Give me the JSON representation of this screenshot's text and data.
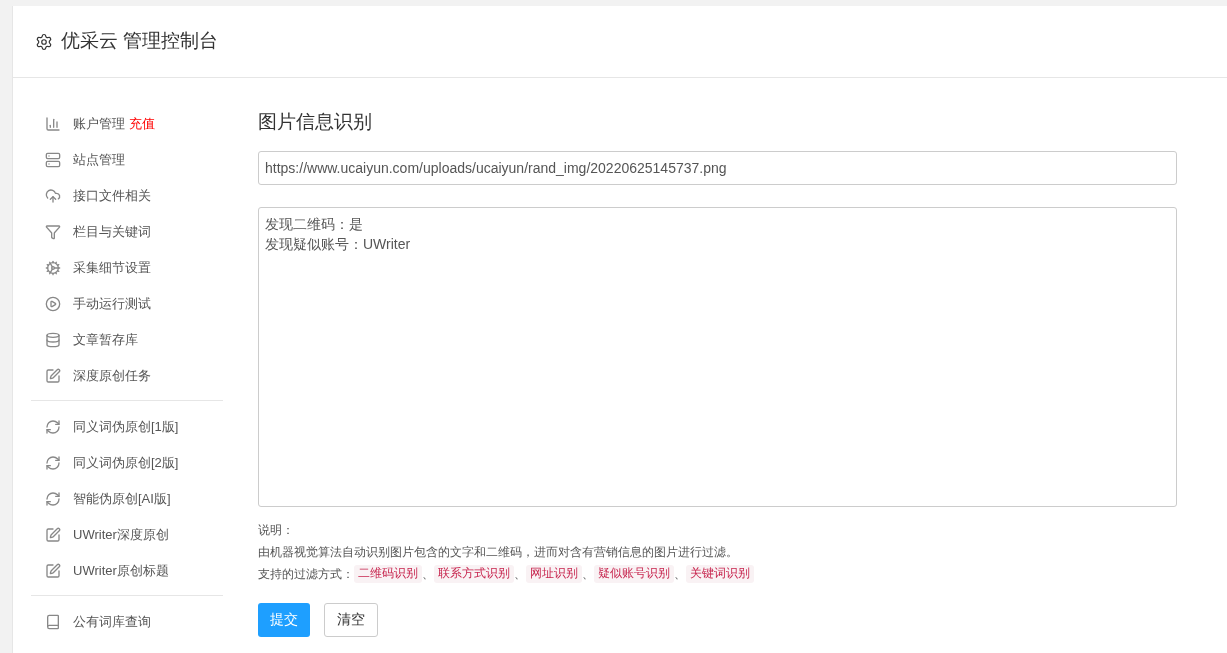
{
  "header": {
    "title": "优采云 管理控制台"
  },
  "sidebar": {
    "groups": [
      {
        "items": [
          {
            "label": "账户管理",
            "badge": "充值"
          },
          {
            "label": "站点管理"
          },
          {
            "label": "接口文件相关"
          },
          {
            "label": "栏目与关键词"
          },
          {
            "label": "采集细节设置"
          },
          {
            "label": "手动运行测试"
          },
          {
            "label": "文章暂存库"
          },
          {
            "label": "深度原创任务"
          }
        ]
      },
      {
        "items": [
          {
            "label": "同义词伪原创[1版]"
          },
          {
            "label": "同义词伪原创[2版]"
          },
          {
            "label": "智能伪原创[AI版]"
          },
          {
            "label": "UWriter深度原创"
          },
          {
            "label": "UWriter原创标题"
          }
        ]
      },
      {
        "items": [
          {
            "label": "公有词库查询"
          }
        ]
      }
    ]
  },
  "main": {
    "heading": "图片信息识别",
    "url_field": {
      "value": "https://www.ucaiyun.com/uploads/ucaiyun/rand_img/20220625145737.png"
    },
    "result_field": {
      "lines": [
        "发现二维码：是",
        "发现疑似账号：UWriter"
      ]
    },
    "note_title": "说明：",
    "note_text": "由机器视觉算法自动识别图片包含的文字和二维码，进而对含有营销信息的图片进行过滤。",
    "filters_label": "支持的过滤方式：",
    "filters": [
      "二维码识别",
      "联系方式识别",
      "网址识别",
      "疑似账号识别",
      "关键词识别"
    ],
    "separator": "、",
    "buttons": [
      {
        "label": "提交",
        "kind": "primary"
      },
      {
        "label": "清空",
        "kind": "default"
      }
    ]
  }
}
